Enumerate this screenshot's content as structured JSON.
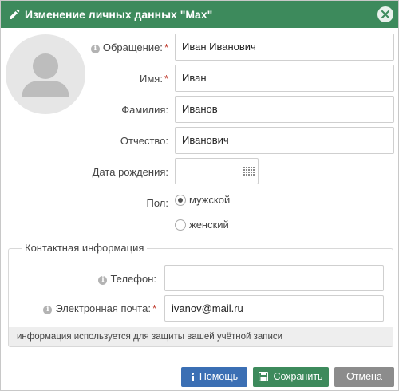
{
  "dialog": {
    "title": "Изменение личных данных \"Max\"",
    "icons": {
      "title_icon": "pencil-icon",
      "close_icon": "close-icon"
    }
  },
  "form": {
    "salutation": {
      "label": "Обращение:",
      "required": "*",
      "value": "Иван Иванович"
    },
    "first_name": {
      "label": "Имя:",
      "required": "*",
      "value": "Иван"
    },
    "last_name": {
      "label": "Фамилия:",
      "value": "Иванов"
    },
    "middle_name": {
      "label": "Отчество:",
      "value": "Иванович"
    },
    "birth_date": {
      "label": "Дата рождения:",
      "value": ""
    },
    "gender": {
      "label": "Пол:",
      "options": [
        "мужской",
        "женский"
      ],
      "selected": "мужской"
    }
  },
  "contacts": {
    "legend": "Контактная информация",
    "phone": {
      "label": "Телефон:",
      "value": ""
    },
    "email": {
      "label": "Электронная почта:",
      "required": "*",
      "value": "ivanov@mail.ru"
    },
    "hint": "информация используется для защиты вашей учётной записи"
  },
  "buttons": {
    "help": "Помощь",
    "save": "Сохранить",
    "cancel": "Отмена"
  },
  "colors": {
    "titlebar": "#3d8a5c",
    "help_button": "#3b6fb4",
    "save_button": "#3d8a5c",
    "cancel_button": "#8c8c8c",
    "required_mark": "#c0392b"
  }
}
